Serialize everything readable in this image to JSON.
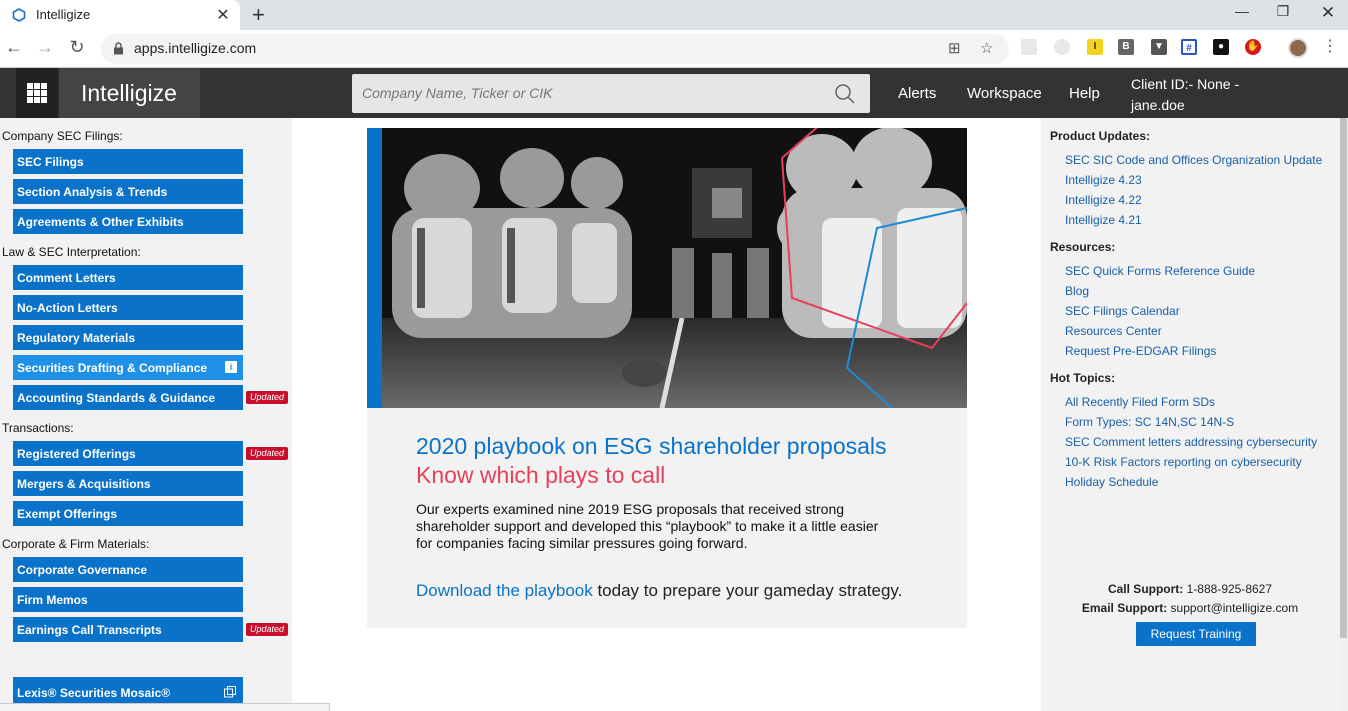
{
  "browser": {
    "tab_title": "Intelligize",
    "url": "apps.intelligize.com"
  },
  "header": {
    "brand": "Intelligize",
    "search_placeholder": "Company Name, Ticker or CIK",
    "links": [
      "Alerts",
      "Workspace",
      "Help"
    ],
    "client_line1": "Client ID:- None -",
    "client_line2": "jane.doe"
  },
  "leftnav": {
    "sections": [
      {
        "label": "Company SEC Filings:",
        "items": [
          {
            "label": "SEC Filings"
          },
          {
            "label": "Section Analysis & Trends"
          },
          {
            "label": "Agreements & Other Exhibits"
          }
        ]
      },
      {
        "label": "Law & SEC Interpretation:",
        "items": [
          {
            "label": "Comment Letters"
          },
          {
            "label": "No-Action Letters"
          },
          {
            "label": "Regulatory Materials"
          },
          {
            "label": "Securities Drafting & Compliance",
            "info": "i"
          },
          {
            "label": "Accounting Standards & Guidance",
            "badge": "Updated"
          }
        ]
      },
      {
        "label": "Transactions:",
        "items": [
          {
            "label": "Registered Offerings",
            "badge": "Updated"
          },
          {
            "label": "Mergers & Acquisitions"
          },
          {
            "label": "Exempt Offerings"
          }
        ]
      },
      {
        "label": "Corporate & Firm Materials:",
        "items": [
          {
            "label": "Corporate Governance"
          },
          {
            "label": "Firm Memos"
          },
          {
            "label": "Earnings Call Transcripts",
            "badge": "Updated"
          }
        ]
      }
    ],
    "mosaic_label": "Lexis® Securities Mosaic®"
  },
  "banner": {
    "title": "2020 playbook on ESG shareholder proposals",
    "subtitle": "Know which plays to call",
    "body": "Our experts examined nine 2019 ESG proposals that received strong shareholder support and developed this “playbook” to make it a little easier for companies facing similar pressures going forward.",
    "cta_link": "Download the playbook",
    "cta_rest": " today to prepare your gameday strategy."
  },
  "rightpanel": {
    "product_updates_label": "Product Updates:",
    "product_updates": [
      "SEC SIC Code and Offices Organization Update",
      "Intelligize 4.23",
      "Intelligize 4.22",
      "Intelligize 4.21"
    ],
    "resources_label": "Resources:",
    "resources": [
      "SEC Quick Forms Reference Guide",
      "Blog",
      "SEC Filings Calendar",
      "Resources Center",
      "Request Pre-EDGAR Filings"
    ],
    "hot_topics_label": "Hot Topics:",
    "hot_topics": [
      "All Recently Filed Form SDs",
      "Form Types: SC 14N,SC 14N-S",
      "SEC Comment letters addressing cybersecurity",
      "10-K Risk Factors reporting on cybersecurity",
      "Holiday Schedule"
    ],
    "call_support_label": "Call Support:",
    "call_support_value": " 1-888-925-8627",
    "email_support_label": "Email Support:",
    "email_support_value": " support@intelligize.com",
    "training_button": "Request Training"
  },
  "colors": {
    "nav_blue": "#0a72c9",
    "accent_pink": "#e8405a",
    "updated_red": "#c8102e"
  }
}
